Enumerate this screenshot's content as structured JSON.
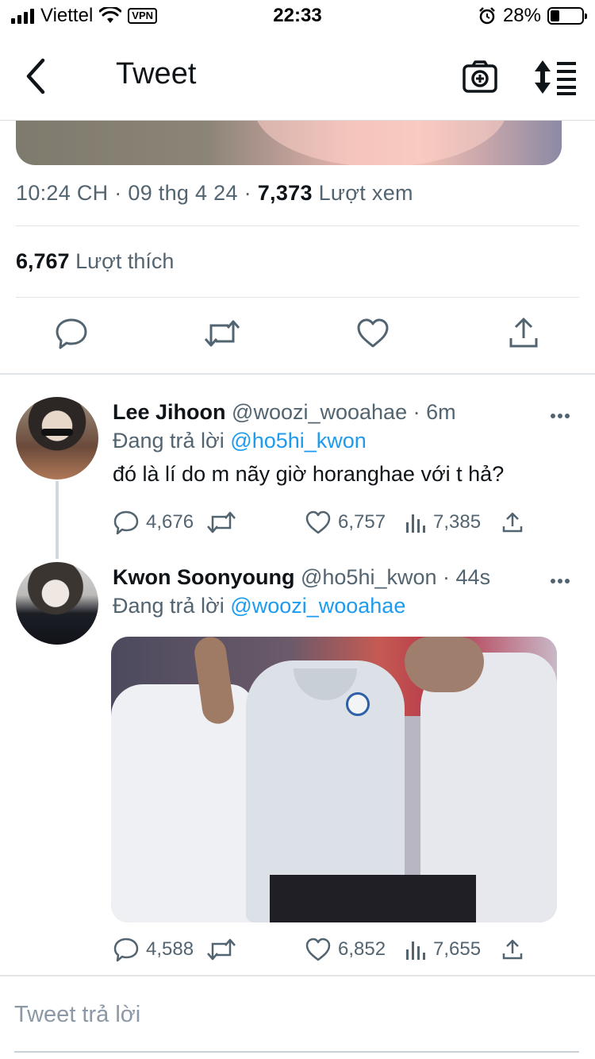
{
  "status_bar": {
    "carrier": "Viettel",
    "vpn": "VPN",
    "time": "22:33",
    "battery": "28%",
    "battery_level": 0.28
  },
  "nav": {
    "title": "Tweet"
  },
  "tweet": {
    "time": "10:24 CH",
    "date": "09 thg 4 24",
    "views_count": "7,373",
    "views_label": "Lượt xem",
    "likes_count": "6,767",
    "likes_label": "Lượt thích"
  },
  "replies": [
    {
      "name": "Lee Jihoon",
      "handle": "@woozi_wooahae",
      "time": "6m",
      "replying_label": "Đang trả lời",
      "replying_to": "@ho5hi_kwon",
      "text": "đó là lí do m nãy giờ horanghae với t hả?",
      "replies": "4,676",
      "likes": "6,757",
      "views": "7,385"
    },
    {
      "name": "Kwon Soonyoung",
      "handle": "@ho5hi_kwon",
      "time": "44s",
      "replying_label": "Đang trả lời",
      "replying_to": "@woozi_wooahae",
      "replies": "4,588",
      "likes": "6,852",
      "views": "7,655"
    }
  ],
  "composer": {
    "placeholder": "Tweet trả lời"
  },
  "colors": {
    "link": "#1d9bf0",
    "secondary_text": "#536471",
    "primary_text": "#0f1419"
  }
}
